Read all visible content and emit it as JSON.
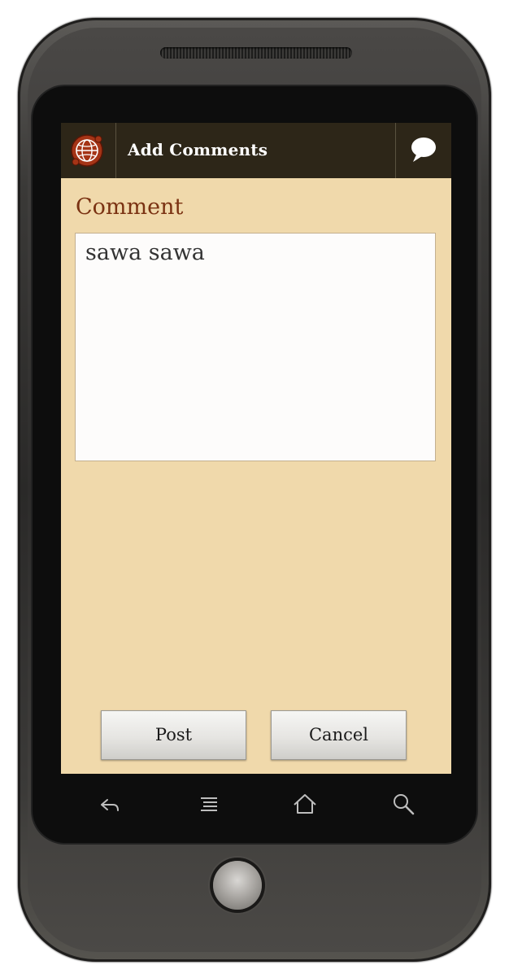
{
  "app": {
    "title": "Add Comments",
    "logo_icon": "globe-logo-icon",
    "action_icon": "speech-bubble-icon"
  },
  "form": {
    "label": "Comment",
    "comment_value": "sawa sawa"
  },
  "buttons": {
    "post_label": "Post",
    "cancel_label": "Cancel"
  },
  "navbar": {
    "icons": [
      "back-icon",
      "menu-icon",
      "home-icon",
      "search-icon"
    ]
  },
  "colors": {
    "titlebar_bg": "#2d2618",
    "screen_bg": "#f0d9ab",
    "label_color": "#7a3212",
    "logo_red": "#8b2a12"
  }
}
